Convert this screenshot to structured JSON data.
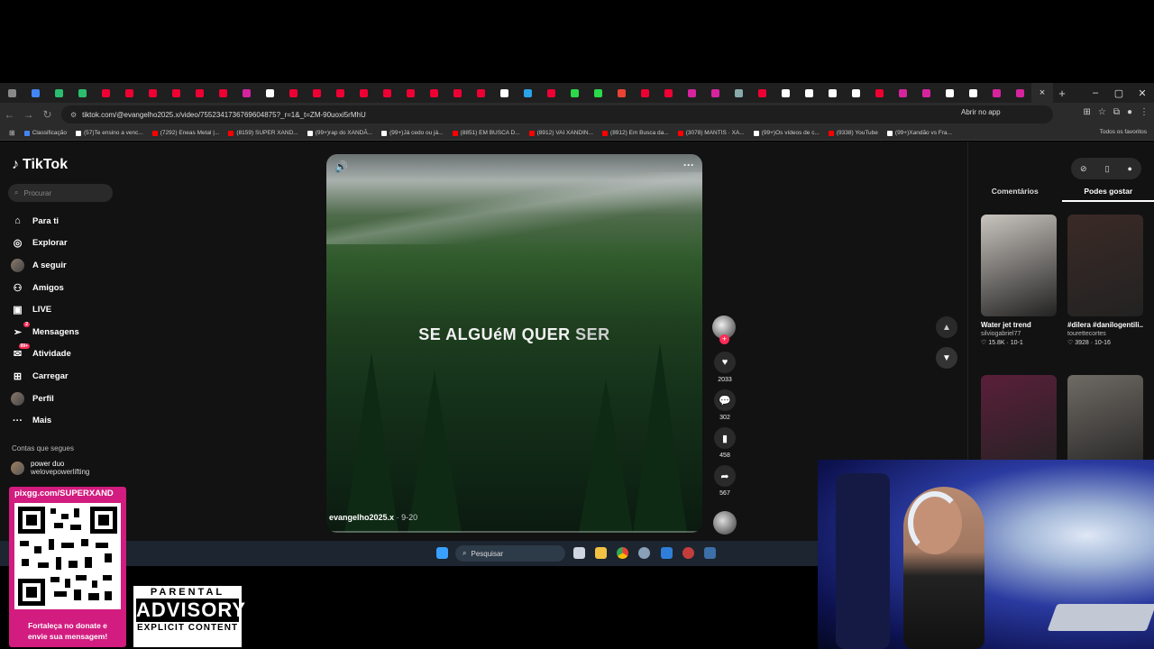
{
  "browser": {
    "active_tab_close": "×",
    "new_tab": "+",
    "window_controls": [
      "–",
      "▢",
      "✕"
    ],
    "url": "tiktok.com/@evangelho2025.x/video/7552341736769604875?_r=1&_t=ZM-90uoxi5rMhU",
    "open_app": "Abrir no app",
    "bookmarks": [
      {
        "label": "Classificação",
        "color": "#4285f4"
      },
      {
        "label": "(57)Te ensino a venc...",
        "color": "#ffffff"
      },
      {
        "label": "(7292) Eneas Metal |...",
        "color": "#ff0000"
      },
      {
        "label": "(8159) SUPER XAND...",
        "color": "#ff0000"
      },
      {
        "label": "(99+)rap do XANDÃ...",
        "color": "#ffffff"
      },
      {
        "label": "(99+)Já cedo ou já...",
        "color": "#ffffff"
      },
      {
        "label": "(8851) EM BUSCA D...",
        "color": "#ff0000"
      },
      {
        "label": "(8912) VAI XANDIN...",
        "color": "#ff0000"
      },
      {
        "label": "(8912) Em Busca da...",
        "color": "#ff0000"
      },
      {
        "label": "(3078) MANTIS · XA...",
        "color": "#ff0000"
      },
      {
        "label": "(99+)Os vídeos de c...",
        "color": "#ffffff"
      },
      {
        "label": "(9338) YouTube",
        "color": "#ff0000"
      },
      {
        "label": "(99+)Xandão vs Fra...",
        "color": "#ffffff"
      }
    ],
    "all_favorites": "Todos os favoritos"
  },
  "tiktok": {
    "logo": "TikTok",
    "search_placeholder": "Procurar",
    "nav": [
      {
        "label": "Para ti",
        "icon": "home-icon"
      },
      {
        "label": "Explorar",
        "icon": "compass-icon"
      },
      {
        "label": "A seguir",
        "icon": "avatar"
      },
      {
        "label": "Amigos",
        "icon": "friends-icon"
      },
      {
        "label": "LIVE",
        "icon": "live-icon"
      },
      {
        "label": "Mensagens",
        "icon": "send-icon",
        "badge": "2"
      },
      {
        "label": "Atividade",
        "icon": "inbox-icon",
        "badge": "99+"
      },
      {
        "label": "Carregar",
        "icon": "plus-icon"
      },
      {
        "label": "Perfil",
        "icon": "avatar"
      },
      {
        "label": "Mais",
        "icon": "more-icon"
      }
    ],
    "following_title": "Contas que segues",
    "following": [
      {
        "name": "power duo",
        "handle": "welovepowerlifting"
      }
    ],
    "video": {
      "caption_main": "SE ALGUéM QUER",
      "caption_dim": "SER",
      "author": "evangelho2025.x",
      "date": "9-20"
    },
    "actions": {
      "likes": "2033",
      "comments": "302",
      "saves": "458",
      "shares": "567"
    },
    "right_tabs": [
      "Comentários",
      "Podes gostar"
    ],
    "cards": [
      {
        "title": "Water jet trend",
        "user": "silviogabriel77",
        "stats": "♡ 15.8K · 10-1",
        "color": "#c9c4be"
      },
      {
        "title": "#dilera #danilogentili...",
        "user": "tourettecortes",
        "stats": "♡ 3928 · 10-16",
        "color": "#3b2a26"
      },
      {
        "title": "",
        "user": "",
        "stats": "",
        "color": "#5a1f3a"
      },
      {
        "title": "",
        "user": "",
        "stats": "",
        "color": "#6f6a64"
      }
    ]
  },
  "taskbar": {
    "search": "Pesquisar"
  },
  "overlay": {
    "qr_header": "pixgg.com/SUPERXAND",
    "qr_footer_1": "Fortaleça no donate e",
    "qr_footer_2": "envie sua mensagem!",
    "pa_line1": "PARENTAL",
    "pa_line2": "ADVISORY",
    "pa_line3": "EXPLICIT CONTENT"
  }
}
